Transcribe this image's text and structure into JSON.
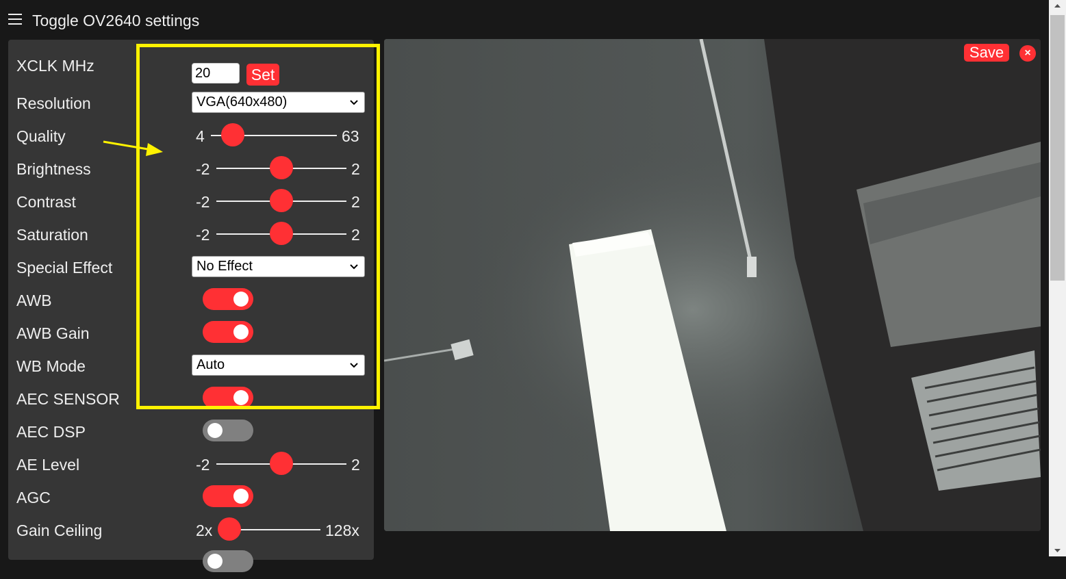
{
  "header": {
    "menu_icon": "hamburger-icon",
    "title": "Toggle OV2640 settings"
  },
  "settings": {
    "xclk": {
      "label": "XCLK MHz",
      "value": "20",
      "button": "Set"
    },
    "resolution": {
      "label": "Resolution",
      "selected": "VGA(640x480)"
    },
    "quality": {
      "label": "Quality",
      "min": "4",
      "max": "63",
      "value": 10
    },
    "brightness": {
      "label": "Brightness",
      "min": "-2",
      "max": "2",
      "value": 0
    },
    "contrast": {
      "label": "Contrast",
      "min": "-2",
      "max": "2",
      "value": 0
    },
    "saturation": {
      "label": "Saturation",
      "min": "-2",
      "max": "2",
      "value": 0
    },
    "special_effect": {
      "label": "Special Effect",
      "selected": "No Effect"
    },
    "awb": {
      "label": "AWB",
      "on": true
    },
    "awb_gain": {
      "label": "AWB Gain",
      "on": true
    },
    "wb_mode": {
      "label": "WB Mode",
      "selected": "Auto"
    },
    "aec_sensor": {
      "label": "AEC SENSOR",
      "on": true
    },
    "aec_dsp": {
      "label": "AEC DSP",
      "on": false
    },
    "ae_level": {
      "label": "AE Level",
      "min": "-2",
      "max": "2",
      "value": 0
    },
    "agc": {
      "label": "AGC",
      "on": true
    },
    "gain_ceiling": {
      "label": "Gain Ceiling",
      "min": "2x",
      "max": "128x",
      "value": 0
    }
  },
  "stream": {
    "save_label": "Save",
    "close_icon": "close-icon"
  },
  "colors": {
    "accent": "#ff3034",
    "highlight": "#fff200",
    "panel": "#363636",
    "background": "#181818"
  }
}
